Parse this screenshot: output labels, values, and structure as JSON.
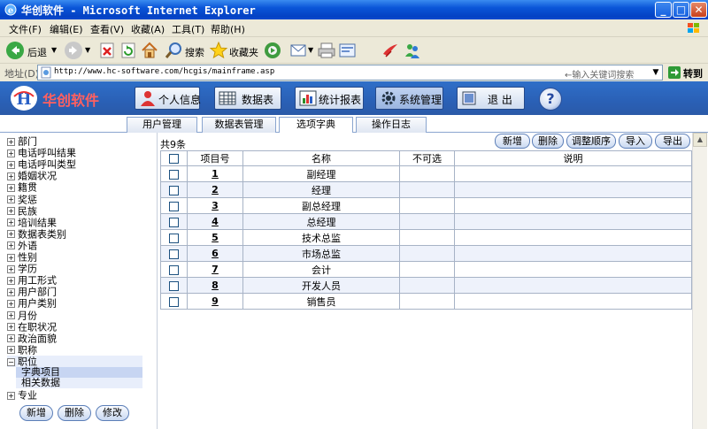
{
  "window": {
    "title": "华创软件 - Microsoft Internet Explorer",
    "min": "_",
    "max": "□",
    "close": "✕"
  },
  "menu": [
    "文件(F)",
    "编辑(E)",
    "查看(V)",
    "收藏(A)",
    "工具(T)",
    "帮助(H)"
  ],
  "toolbar": {
    "back": "后退",
    "search": "搜索",
    "favorites": "收藏夹"
  },
  "address": {
    "label": "地址(D)",
    "url": "http://www.hc-software.com/hcgis/mainframe.asp",
    "keyword_placeholder": "←输入关键词搜索",
    "go": "转到"
  },
  "app": {
    "logo": "华创软件",
    "nav": [
      "个人信息",
      "数据表",
      "统计报表",
      "系统管理",
      "退  出"
    ],
    "help": "?"
  },
  "tabs": [
    "用户管理",
    "数据表管理",
    "选项字典",
    "操作日志"
  ],
  "tree": {
    "nodes": [
      "部门",
      "电话呼叫结果",
      "电话呼叫类型",
      "婚姻状况",
      "籍贯",
      "奖惩",
      "民族",
      "培训结果",
      "数据表类别",
      "外语",
      "性别",
      "学历",
      "用工形式",
      "用户部门",
      "用户类别",
      "月份",
      "在职状况",
      "政治面貌",
      "职称"
    ],
    "expanded": "职位",
    "children": [
      "字典项目",
      "相关数据"
    ],
    "last": "专业",
    "collapsed_symbol": "+",
    "expanded_symbol": "−",
    "buttons": [
      "新增",
      "删除",
      "修改"
    ]
  },
  "grid": {
    "count": "共9条",
    "actions": [
      "新增",
      "删除",
      "调整顺序",
      "导入",
      "导出"
    ],
    "headers": [
      "项目号",
      "名称",
      "不可选",
      "说明"
    ],
    "rows": [
      {
        "id": "1",
        "name": "副经理"
      },
      {
        "id": "2",
        "name": "经理"
      },
      {
        "id": "3",
        "name": "副总经理"
      },
      {
        "id": "4",
        "name": "总经理"
      },
      {
        "id": "5",
        "name": "技术总监"
      },
      {
        "id": "6",
        "name": "市场总监"
      },
      {
        "id": "7",
        "name": "会计"
      },
      {
        "id": "8",
        "name": "开发人员"
      },
      {
        "id": "9",
        "name": "销售员"
      }
    ]
  }
}
